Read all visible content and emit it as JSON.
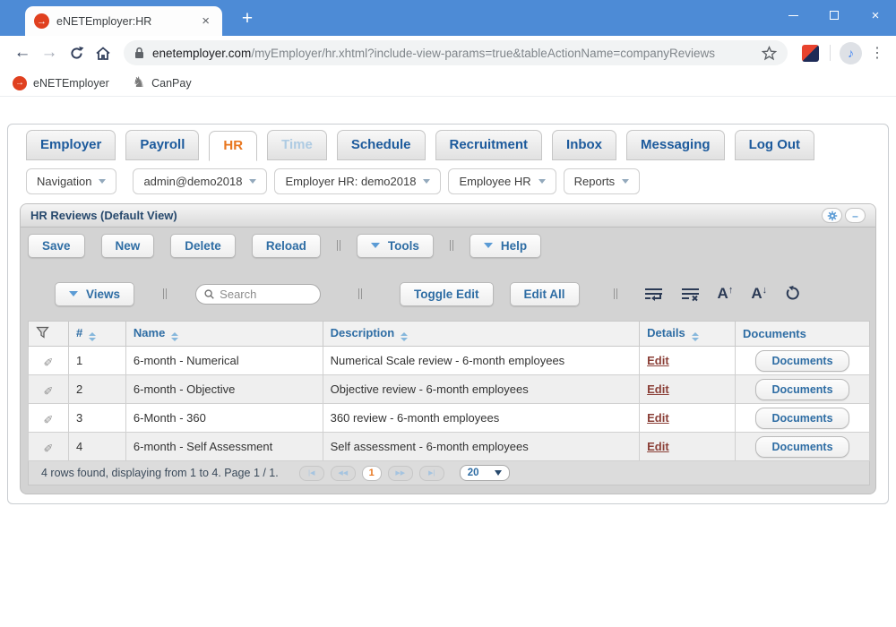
{
  "colors": {
    "titlebar_blue": "#4D8BD6",
    "tab_text_blue": "#1C5A9C",
    "active_tab_orange": "#E8761F",
    "button_text_blue": "#2E6DA4",
    "edit_link_maroon": "#8B4038",
    "panel_gray": "#D3D3D3",
    "logo_red": "#E0401F"
  },
  "browser": {
    "tab_title": "eNETEmployer:HR",
    "tab_close": "×",
    "new_tab_button": "+",
    "window_controls": {
      "close": "×"
    },
    "nav": {
      "back": "←",
      "forward": "→"
    },
    "address": {
      "domain": "enetemployer.com",
      "path": "/myEmployer/hr.xhtml?include-view-params=true&tableActionName=companyReviews"
    },
    "avatar_glyph": "♪",
    "menu_glyph": "⋮",
    "logo_glyph": "→",
    "bookmarks": [
      {
        "label": "eNETEmployer"
      },
      {
        "label": "CanPay",
        "glyph": "♞"
      }
    ]
  },
  "app": {
    "tabs": [
      {
        "label": "Employer",
        "state": "normal"
      },
      {
        "label": "Payroll",
        "state": "normal"
      },
      {
        "label": "HR",
        "state": "active"
      },
      {
        "label": "Time",
        "state": "disabled"
      },
      {
        "label": "Schedule",
        "state": "normal"
      },
      {
        "label": "Recruitment",
        "state": "normal"
      },
      {
        "label": "Inbox",
        "state": "normal"
      },
      {
        "label": "Messaging",
        "state": "normal"
      },
      {
        "label": "Log Out",
        "state": "normal"
      }
    ],
    "nav_dropdowns": [
      {
        "label": "Navigation"
      },
      {
        "label": "admin@demo2018"
      },
      {
        "label": "Employer HR: demo2018"
      },
      {
        "label": "Employee HR"
      },
      {
        "label": "Reports"
      }
    ],
    "panel": {
      "title": "HR Reviews (Default View)",
      "minimize_glyph": "–",
      "actions": {
        "save": "Save",
        "new": "New",
        "delete": "Delete",
        "reload": "Reload",
        "tools": "Tools",
        "help": "Help"
      },
      "grid_toolbar": {
        "views": "Views",
        "search_placeholder": "Search",
        "toggle_edit": "Toggle Edit",
        "edit_all": "Edit All",
        "font_letter": "A",
        "arrow_up": "↑",
        "arrow_down": "↓"
      }
    },
    "table": {
      "headers": {
        "num": "#",
        "name": "Name",
        "description": "Description",
        "details": "Details",
        "documents": "Documents"
      },
      "pencil_glyph": "✎",
      "rows": [
        {
          "num": "1",
          "name": "6-month - Numerical",
          "description": "Numerical Scale review - 6-month employees",
          "details": "Edit",
          "documents": "Documents"
        },
        {
          "num": "2",
          "name": "6-month - Objective",
          "description": "Objective review - 6-month employees",
          "details": "Edit",
          "documents": "Documents"
        },
        {
          "num": "3",
          "name": "6-Month - 360",
          "description": "360 review - 6-month employees",
          "details": "Edit",
          "documents": "Documents"
        },
        {
          "num": "4",
          "name": "6-month - Self Assessment",
          "description": "Self assessment - 6-month employees",
          "details": "Edit",
          "documents": "Documents"
        }
      ]
    },
    "pagination": {
      "status": "4 rows found, displaying from 1 to 4. Page 1 / 1.",
      "first": "|◀",
      "prev": "◀◀",
      "current": "1",
      "next": "▶▶",
      "last": "▶|",
      "page_size": "20"
    }
  }
}
